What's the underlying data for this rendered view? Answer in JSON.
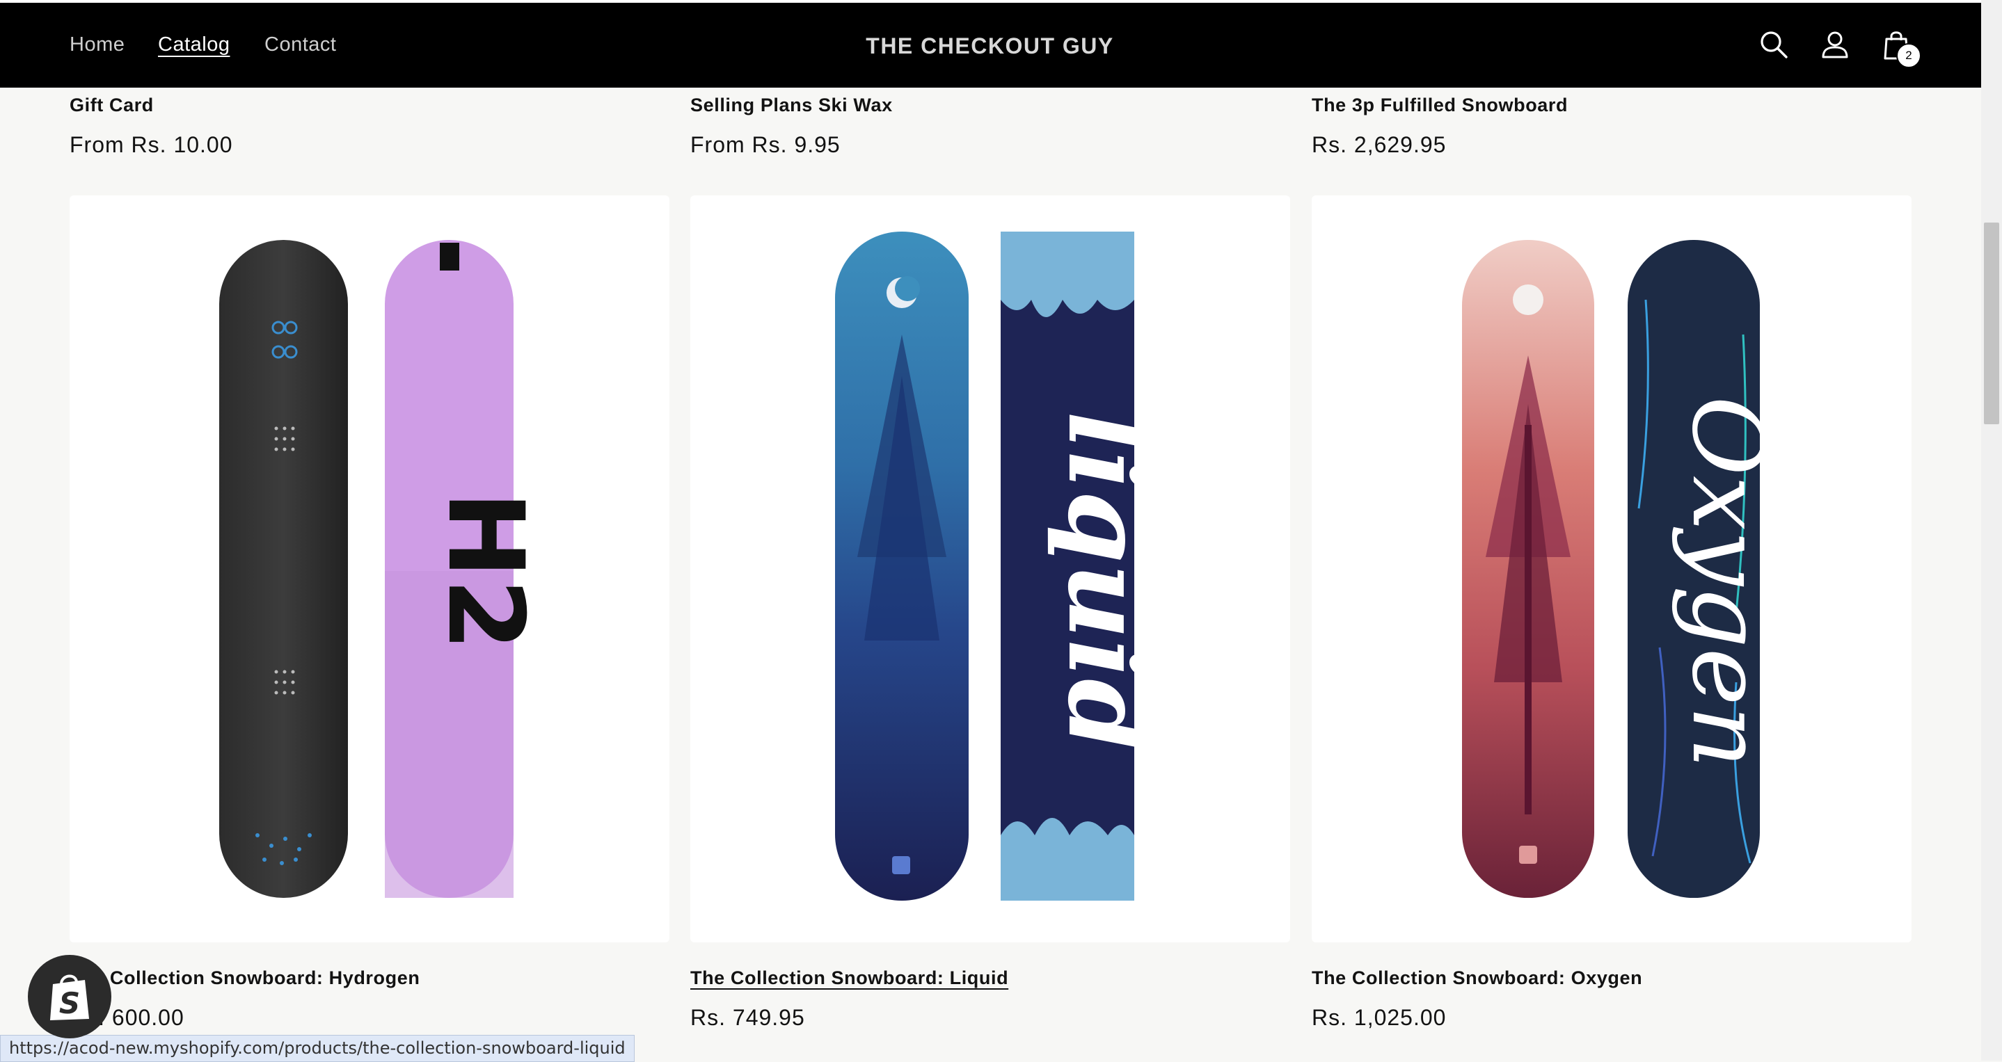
{
  "header": {
    "nav": [
      "Home",
      "Catalog",
      "Contact"
    ],
    "active_nav": "Catalog",
    "brand": "THE CHECKOUT GUY",
    "cart_count": "2",
    "icons": [
      "search-icon",
      "account-icon",
      "cart-icon"
    ]
  },
  "previous_row": [
    {
      "title": "Gift Card",
      "price": "From Rs. 10.00"
    },
    {
      "title": "Selling Plans Ski Wax",
      "price": "From Rs. 9.95"
    },
    {
      "title": "The 3p Fulfilled Snowboard",
      "price": "Rs. 2,629.95"
    }
  ],
  "products": [
    {
      "title": "The Collection Snowboard: Hydrogen",
      "price": "Rs. 600.00",
      "board_text": "H2"
    },
    {
      "title": "The Collection Snowboard: Liquid",
      "price": "Rs. 749.95",
      "board_text": "liquid"
    },
    {
      "title": "The Collection Snowboard: Oxygen",
      "price": "Rs. 1,025.00",
      "board_text": "Oxygen"
    }
  ],
  "status_url": "https://acod-new.myshopify.com/products/the-collection-snowboard-liquid",
  "colors": {
    "header_bg": "#000000",
    "page_bg": "#f7f7f5",
    "hydrogen_top": "#3a3a3a",
    "hydrogen_base": "#cf9de6",
    "liquid_top": "#3a86b5",
    "liquid_base": "#1e2455",
    "oxygen_top": "#e7b4aa",
    "oxygen_base": "#1d2b45"
  }
}
